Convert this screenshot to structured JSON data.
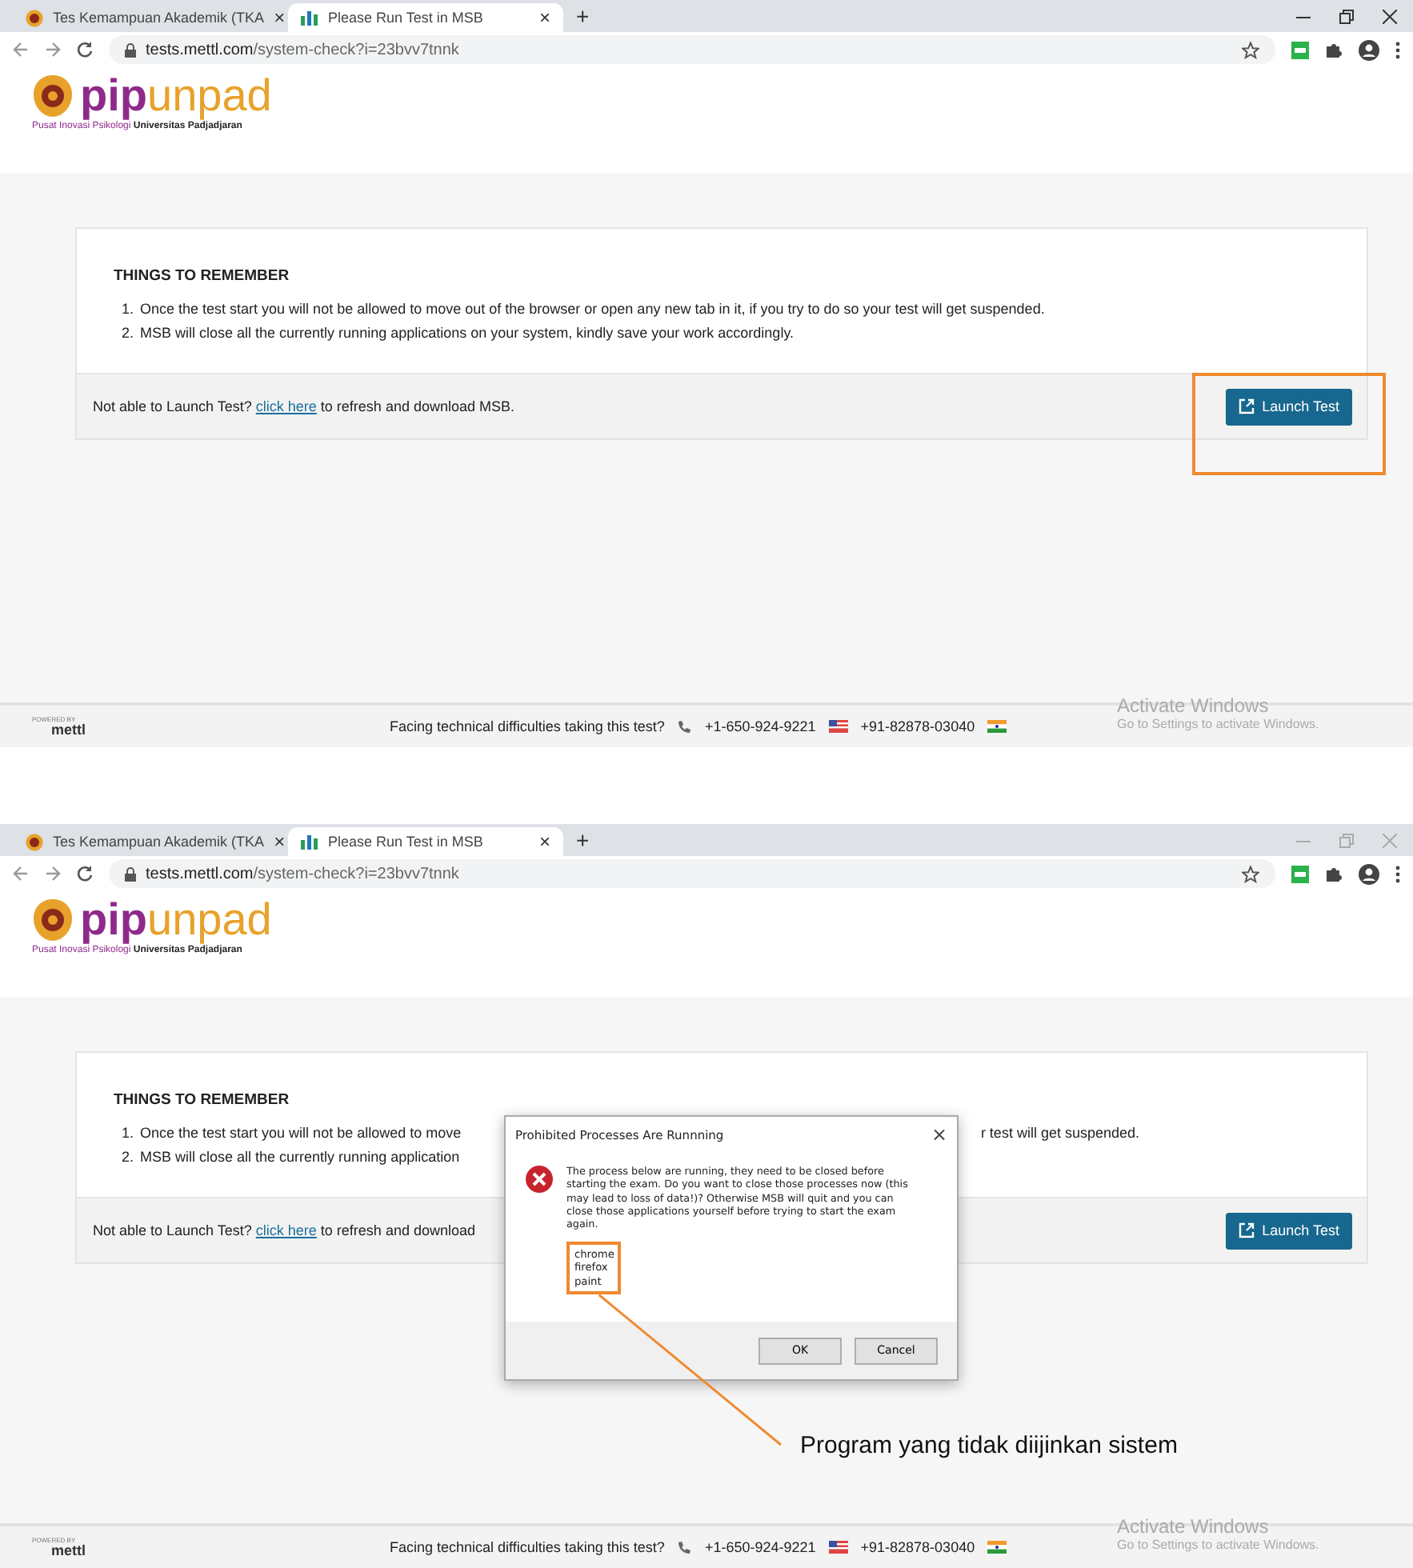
{
  "screens": [
    {
      "window_focused": true,
      "tabs": [
        {
          "title": "Tes Kemampuan Akademik (TKA",
          "selected": false,
          "close": "×"
        },
        {
          "title": "Please Run Test in MSB",
          "selected": true,
          "close": "×"
        }
      ],
      "new_tab": "+",
      "address": {
        "host": "tests.mettl.com",
        "path": "/system-check?i=23bvv7tnnk"
      },
      "logo": {
        "pip": "pip",
        "unpad": "unpad",
        "tagline": "Pusat Inovasi Psikologi",
        "university": "Universitas Padjadjaran"
      },
      "card": {
        "heading": "THINGS TO REMEMBER",
        "items": [
          {
            "number": "1.",
            "text": "Once the test start you will not be allowed to move out of the browser or open any new tab in it, if you try to do so your test will get suspended."
          },
          {
            "number": "2.",
            "text": "MSB will close all the currently running applications on your system, kindly save your work accordingly."
          }
        ],
        "help": {
          "before": "Not able to Launch Test?",
          "link": "click here",
          "after": "to refresh and download MSB."
        },
        "button": "Launch Test"
      },
      "footer": {
        "powered": "POWERED BY",
        "brand": "mettl",
        "question": "Facing technical difficulties taking this test?",
        "phone_us": "+1-650-924-9221",
        "phone_in": "+91-82878-03040"
      },
      "os_notice": {
        "title": "Activate Windows",
        "subtitle": "Go to Settings to activate Windows."
      },
      "annotation": {
        "kind": "frame"
      }
    },
    {
      "window_focused": false,
      "tabs": [
        {
          "title": "Tes Kemampuan Akademik (TKA",
          "selected": false,
          "close": "×"
        },
        {
          "title": "Please Run Test in MSB",
          "selected": true,
          "close": "×"
        }
      ],
      "new_tab": "+",
      "address": {
        "host": "tests.mettl.com",
        "path": "/system-check?i=23bvv7tnnk"
      },
      "logo": {
        "pip": "pip",
        "unpad": "unpad",
        "tagline": "Pusat Inovasi Psikologi",
        "university": "Universitas Padjadjaran"
      },
      "card": {
        "heading": "THINGS TO REMEMBER",
        "items": [
          {
            "number": "1.",
            "text": "Once the test start you will not be allowed to move",
            "tail": "r test will get suspended."
          },
          {
            "number": "2.",
            "text": "MSB will close all the currently running application"
          }
        ],
        "help": {
          "before": "Not able to Launch Test?",
          "link": "click here",
          "after": "to refresh and download"
        },
        "button": "Launch Test"
      },
      "dialog": {
        "title": "Prohibited Processes Are Runnning",
        "close": "×",
        "message": "The process below are running, they need to be closed before starting the exam. Do you want to close those processes now (this may lead to loss of data!)? Otherwise MSB will quit and you can close those applications yourself before trying to start the exam again.",
        "processes": [
          "chrome",
          "firefox",
          "paint"
        ],
        "buttons": [
          "OK",
          "Cancel"
        ]
      },
      "footer": {
        "powered": "POWERED BY",
        "brand": "mettl",
        "question": "Facing technical difficulties taking this test?",
        "phone_us": "+1-650-924-9221",
        "phone_in": "+91-82878-03040"
      },
      "os_notice": {
        "title": "Activate Windows",
        "subtitle": "Go to Settings to activate Windows."
      },
      "annotation": {
        "kind": "callout",
        "caption": "Program yang tidak diijinkan sistem"
      }
    }
  ]
}
